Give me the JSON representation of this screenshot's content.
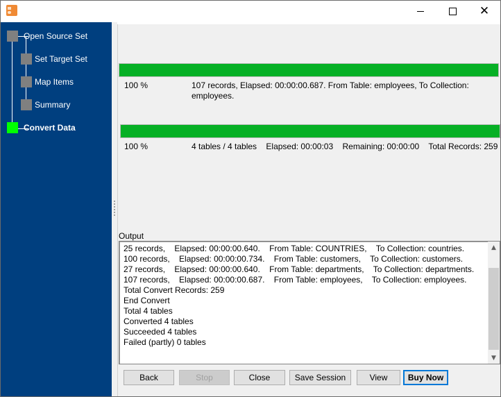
{
  "window": {
    "title": "",
    "controls": {
      "minimize": "minimize",
      "maximize": "maximize",
      "close": "close"
    }
  },
  "sidebar": {
    "steps": [
      {
        "label": "Open Source Set",
        "state": "done"
      },
      {
        "label": "Set Target Set",
        "state": "done"
      },
      {
        "label": "Map Items",
        "state": "done"
      },
      {
        "label": "Summary",
        "state": "done"
      },
      {
        "label": "Convert Data",
        "state": "active"
      }
    ]
  },
  "progress": {
    "table": {
      "percent_value": 100,
      "percent_label": "100 %",
      "info": "107 records,    Elapsed: 00:00:00.687.    From Table: employees,    To Collection: employees."
    },
    "total": {
      "percent_value": 100,
      "percent_label": "100 %",
      "info": "4 tables / 4 tables    Elapsed: 00:00:03    Remaining: 00:00:00    Total Records: 259"
    },
    "fill_color": "#06b025"
  },
  "output": {
    "label": "Output",
    "lines": [
      "25 records,    Elapsed: 00:00:00.640.    From Table: COUNTRIES,    To Collection: countries.",
      "100 records,    Elapsed: 00:00:00.734.    From Table: customers,    To Collection: customers.",
      "27 records,    Elapsed: 00:00:00.640.    From Table: departments,    To Collection: departments.",
      "107 records,    Elapsed: 00:00:00.687.    From Table: employees,    To Collection: employees.",
      "Total Convert Records: 259",
      "End Convert",
      "Total 4 tables",
      "Converted 4 tables",
      "Succeeded 4 tables",
      "Failed (partly) 0 tables"
    ]
  },
  "buttons": {
    "back": "Back",
    "stop": "Stop",
    "close": "Close",
    "save_session": "Save Session",
    "view": "View",
    "buy_now": "Buy Now"
  },
  "colors": {
    "sidebar_bg": "#003f7f",
    "step_done": "#808080",
    "step_active": "#00ff00",
    "default_button_border": "#0078d7"
  }
}
